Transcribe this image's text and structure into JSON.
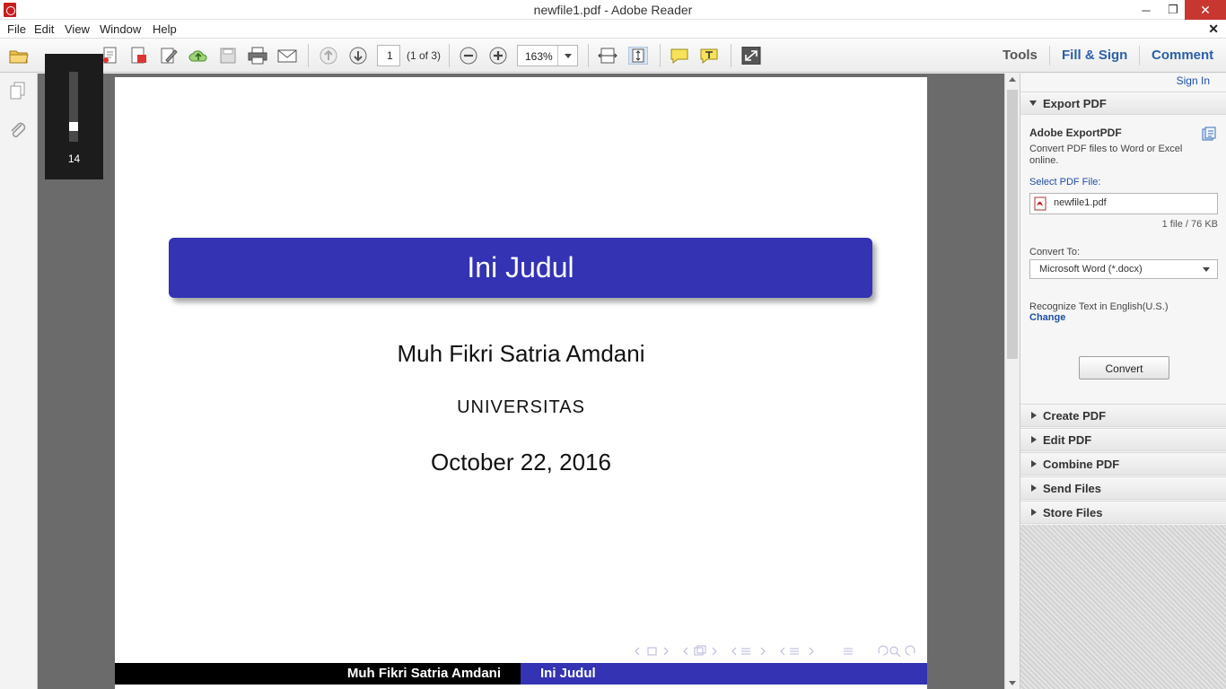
{
  "window": {
    "title": "newfile1.pdf - Adobe Reader",
    "controls": {
      "minimize": "─",
      "maximize": "❐",
      "close": "✕"
    }
  },
  "menu": {
    "items": [
      "File",
      "Edit",
      "View",
      "Window",
      "Help"
    ],
    "close_glyph": "✕"
  },
  "toolbar": {
    "page_number": "1",
    "page_count": "(1 of 3)",
    "zoom": "163%",
    "right_tabs": [
      "Tools",
      "Fill & Sign",
      "Comment"
    ]
  },
  "zoom_slider": {
    "value_label": "14",
    "level_fraction": 0.18
  },
  "document": {
    "slide_title": "Ini Judul",
    "author": "Muh Fikri Satria Amdani",
    "institute": "UNIVERSITAS",
    "date": "October 22, 2016",
    "footer_left": "Muh Fikri Satria Amdani",
    "footer_right": "Ini Judul"
  },
  "right_panel": {
    "sign_in": "Sign In",
    "export": {
      "header": "Export PDF",
      "title": "Adobe ExportPDF",
      "description": "Convert PDF files to Word or Excel online.",
      "select_label": "Select PDF File:",
      "file_name": "newfile1.pdf",
      "file_size": "1 file / 76 KB",
      "convert_to_label": "Convert To:",
      "convert_to_value": "Microsoft Word (*.docx)",
      "recognize_text": "Recognize Text in English(U.S.)",
      "change_link": "Change",
      "convert_button": "Convert"
    },
    "sections": [
      "Create PDF",
      "Edit PDF",
      "Combine PDF",
      "Send Files",
      "Store Files"
    ]
  },
  "colors": {
    "beamer_blue": "#3333b3",
    "link_blue": "#2c5fa8",
    "close_red": "#c7372f"
  }
}
